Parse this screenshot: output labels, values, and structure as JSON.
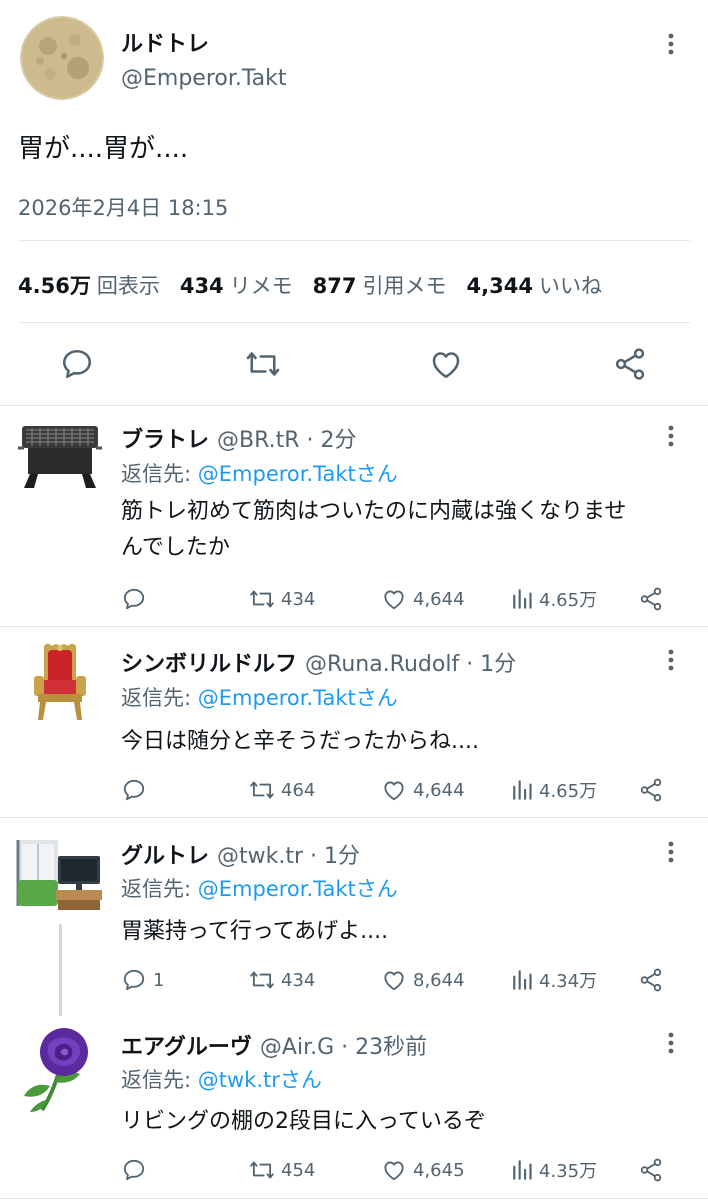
{
  "main": {
    "name": "ルドトレ",
    "handle": "@Emperor.Takt",
    "text": "胃が....胃が....",
    "time": "2026年2月4日 18:15",
    "stats": [
      {
        "value": "4.56万",
        "label": "回表示"
      },
      {
        "value": "434",
        "label": "リメモ"
      },
      {
        "value": "877",
        "label": "引用メモ"
      },
      {
        "value": "4,344",
        "label": "いいね"
      }
    ]
  },
  "replies": [
    {
      "name": "ブラトレ",
      "meta": "@BR.tR · 2分",
      "reply_prefix": "返信先: ",
      "reply_to": "@Emperor.Taktさん",
      "text_line1": "筋トレ初めて筋肉はついたのに内蔵は強くなりませ",
      "text_line2": "んでしたか",
      "replies": "",
      "retweets": "434",
      "likes": "4,644",
      "views": "4.65万"
    },
    {
      "name": "シンボリルドルフ",
      "meta": "@Runa.Rudolf · 1分",
      "reply_prefix": "返信先: ",
      "reply_to": "@Emperor.Taktさん",
      "text_line1": "今日は随分と辛そうだったからね....",
      "replies": "",
      "retweets": "464",
      "likes": "4,644",
      "views": "4.65万"
    },
    {
      "name": "グルトレ",
      "meta": "@twk.tr · 1分",
      "reply_prefix": "返信先: ",
      "reply_to": "@Emperor.Taktさん",
      "text_line1": "胃薬持って行ってあげよ....",
      "replies": "1",
      "retweets": "434",
      "likes": "8,644",
      "views": "4.34万"
    },
    {
      "name": "エアグルーヴ",
      "meta": "@Air.G · 23秒前",
      "reply_prefix": "返信先: ",
      "reply_to": "@twk.trさん",
      "text_line1": "リビングの棚の2段目に入っているぞ",
      "replies": "",
      "retweets": "454",
      "likes": "4,645",
      "views": "4.35万"
    }
  ],
  "colors": {
    "link": "#1d9bf0",
    "secondary": "#536471",
    "divider": "#e6e9ec"
  },
  "icons": [
    "moon-avatar",
    "grill-avatar",
    "throne-avatar",
    "room-avatar",
    "purple-rose-avatar",
    "reply-icon",
    "retweet-icon",
    "like-icon",
    "views-icon",
    "share-icon",
    "more-icon"
  ]
}
